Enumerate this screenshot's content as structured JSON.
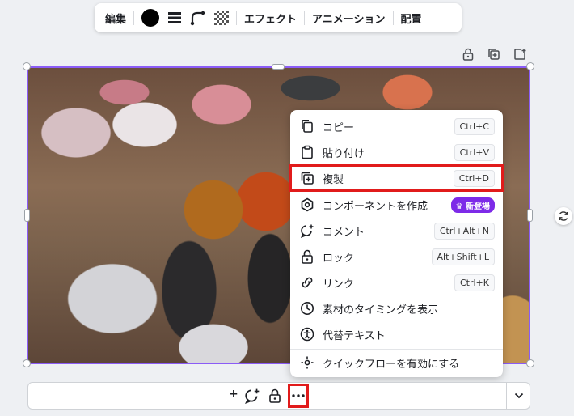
{
  "toolbar": {
    "edit": "編集",
    "effect": "エフェクト",
    "animation": "アニメーション",
    "position": "配置",
    "fill_color": "#000000"
  },
  "context_menu": {
    "items": [
      {
        "label": "コピー",
        "shortcut": "Ctrl+C",
        "icon": "copy-icon"
      },
      {
        "label": "貼り付け",
        "shortcut": "Ctrl+V",
        "icon": "paste-icon"
      },
      {
        "label": "複製",
        "shortcut": "Ctrl+D",
        "icon": "duplicate-icon",
        "highlighted": true
      },
      {
        "label": "コンポーネントを作成",
        "badge": "新登場",
        "icon": "component-icon"
      },
      {
        "label": "コメント",
        "shortcut": "Ctrl+Alt+N",
        "icon": "comment-icon"
      },
      {
        "label": "ロック",
        "shortcut": "Alt+Shift+L",
        "icon": "lock-icon"
      },
      {
        "label": "リンク",
        "shortcut": "Ctrl+K",
        "icon": "link-icon"
      },
      {
        "label": "素材のタイミングを表示",
        "icon": "clock-icon"
      },
      {
        "label": "代替テキスト",
        "icon": "accessibility-icon"
      },
      {
        "label": "クイックフローを有効にする",
        "icon": "quick-flow-icon"
      }
    ]
  },
  "bottom": {
    "plus": "+"
  },
  "colors": {
    "selection": "#8b5cf6",
    "highlight": "#e11b1b",
    "badge": "#7d2ae8"
  }
}
